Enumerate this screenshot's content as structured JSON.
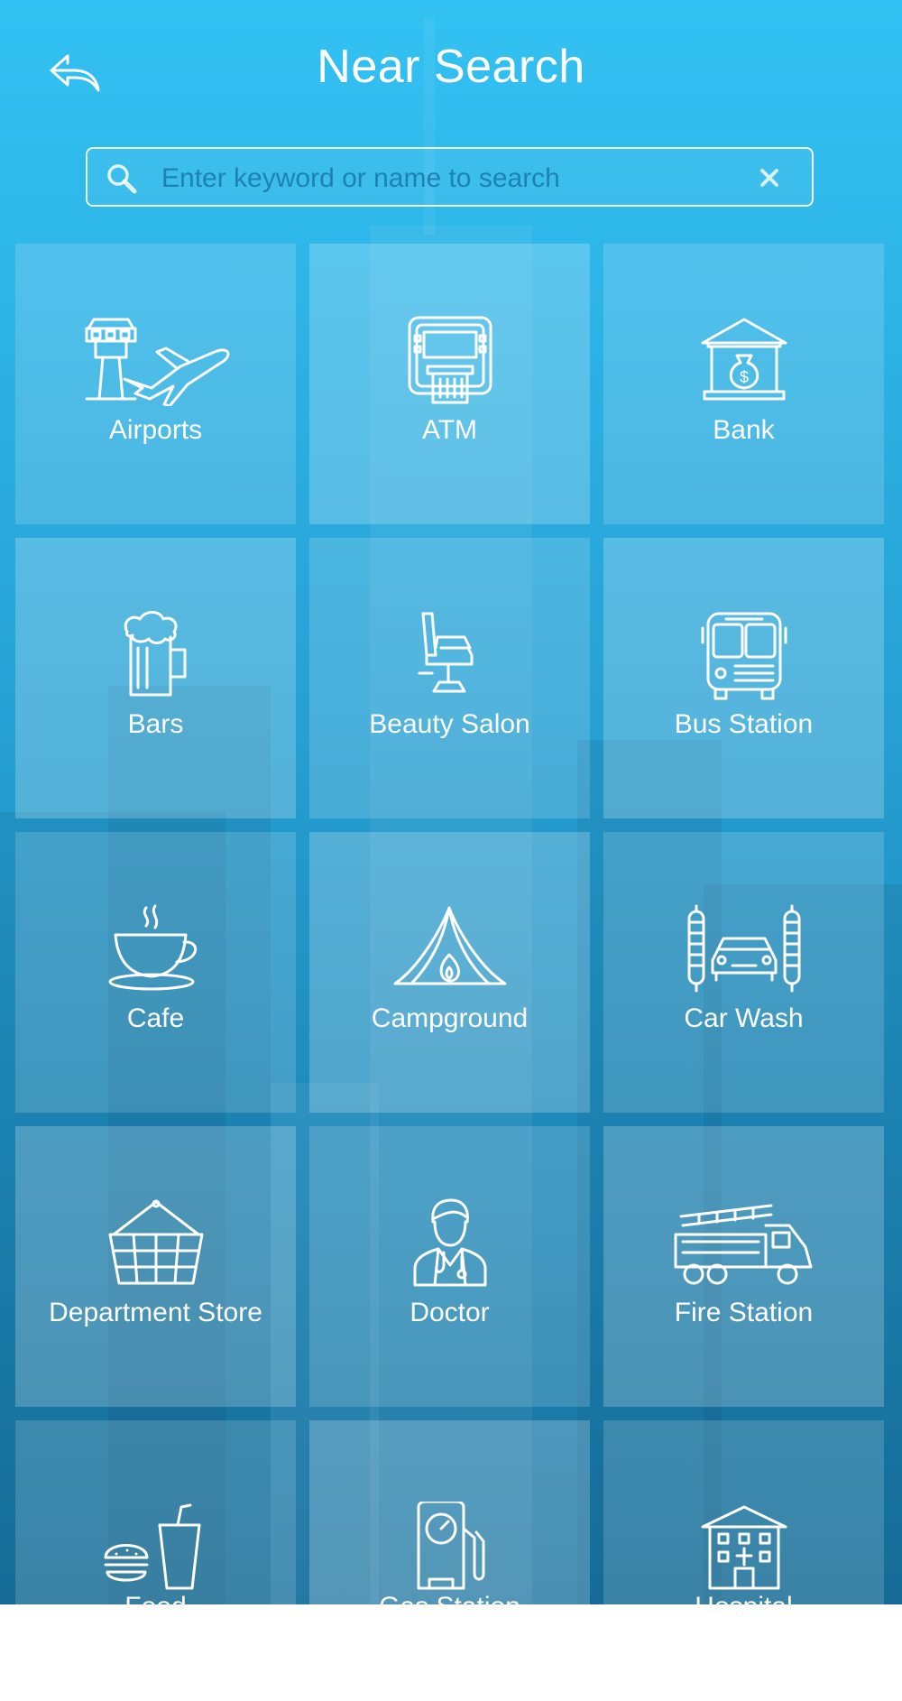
{
  "header": {
    "title": "Near Search",
    "back_icon": "reply-arrow-icon"
  },
  "search": {
    "placeholder": "Enter keyword or name to search",
    "value": "",
    "search_icon": "magnifier-icon",
    "clear_icon": "close-x-icon"
  },
  "categories": [
    {
      "label": "Airports",
      "icon": "airport-icon"
    },
    {
      "label": "ATM",
      "icon": "atm-icon"
    },
    {
      "label": "Bank",
      "icon": "bank-icon"
    },
    {
      "label": "Bars",
      "icon": "beer-mug-icon"
    },
    {
      "label": "Beauty Salon",
      "icon": "salon-chair-icon"
    },
    {
      "label": "Bus Station",
      "icon": "bus-icon"
    },
    {
      "label": "Cafe",
      "icon": "coffee-cup-icon"
    },
    {
      "label": "Campground",
      "icon": "tent-icon"
    },
    {
      "label": "Car Wash",
      "icon": "car-wash-icon"
    },
    {
      "label": "Department Store",
      "icon": "basket-icon"
    },
    {
      "label": "Doctor",
      "icon": "doctor-icon"
    },
    {
      "label": "Fire Station",
      "icon": "fire-truck-icon"
    },
    {
      "label": "Food",
      "icon": "burger-drink-icon"
    },
    {
      "label": "Gas Station",
      "icon": "gas-pump-icon"
    },
    {
      "label": "Hospital",
      "icon": "hospital-icon"
    }
  ],
  "colors": {
    "background_top": "#33c2f3",
    "background_bottom": "#17719e",
    "text": "#ffffff"
  }
}
